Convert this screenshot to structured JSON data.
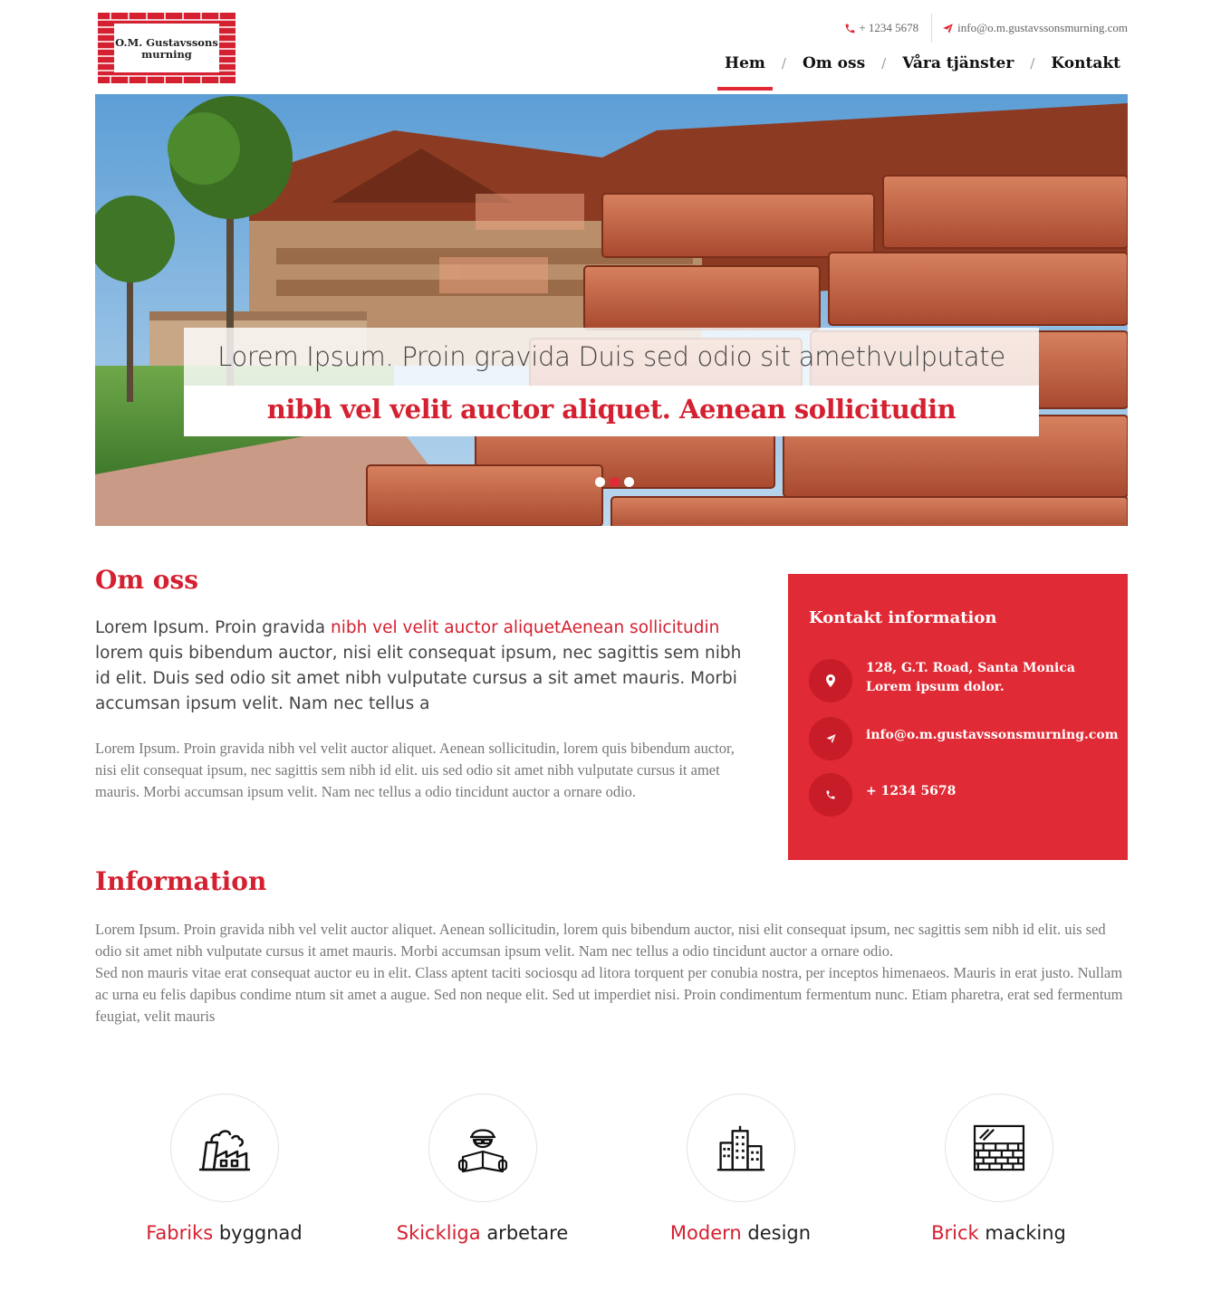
{
  "logo": {
    "line1": "O.M. Gustavssons",
    "line2": "murning"
  },
  "topbar": {
    "phone": "+ 1234 5678",
    "email": "info@o.m.gustavssonsmurning.com"
  },
  "nav": {
    "items": [
      "Hem",
      "Om oss",
      "Våra tjänster",
      "Kontakt"
    ],
    "separator": "/",
    "active": "Hem"
  },
  "hero": {
    "line1": "Lorem Ipsum. Proin gravida Duis sed odio sit amethvulputate",
    "line2": "nibh vel velit auctor aliquet. Aenean sollicitudin",
    "slides": 3,
    "active_slide": 2
  },
  "om_oss": {
    "title": "Om oss",
    "lead_start": "Lorem Ipsum. Proin gravida ",
    "lead_highlight": "nibh vel velit auctor aliquetAenean sollicitudin",
    "lead_end": " lorem quis bibendum auctor, nisi elit consequat ipsum, nec sagittis sem nibh id elit. Duis sed odio sit amet nibh vulputate cursus a sit amet mauris. Morbi accumsan ipsum velit. Nam nec tellus a",
    "body": "Lorem Ipsum. Proin gravida nibh vel velit auctor aliquet. Aenean sollicitudin, lorem quis bibendum auctor, nisi elit consequat ipsum, nec sagittis sem nibh id elit. uis sed odio sit amet nibh vulputate cursus it amet mauris. Morbi accumsan ipsum velit. Nam nec tellus a odio tincidunt auctor a ornare odio."
  },
  "contact": {
    "title": "Kontakt information",
    "address": "128, G.T. Road, Santa Monica Lorem ipsum dolor.",
    "email": "info@o.m.gustavssonsmurning.com",
    "phone": "+ 1234 5678"
  },
  "information": {
    "title": "Information",
    "para1": "Lorem Ipsum. Proin gravida nibh vel velit auctor aliquet. Aenean sollicitudin, lorem quis bibendum auctor, nisi elit consequat ipsum, nec sagittis sem nibh id elit. uis sed odio sit amet nibh vulputate cursus it amet mauris. Morbi accumsan ipsum velit. Nam nec tellus a odio tincidunt auctor a ornare odio.",
    "para2": "Sed non mauris vitae erat consequat auctor eu in elit. Class aptent taciti sociosqu ad litora torquent per conubia nostra, per inceptos himenaeos. Mauris in erat justo. Nullam ac urna eu felis dapibus condime ntum sit amet a augue. Sed non neque elit. Sed ut imperdiet nisi. Proin condimentum fermentum nunc. Etiam pharetra, erat sed fermentum feugiat, velit mauris"
  },
  "features": [
    {
      "red": "Fabriks",
      "rest": " byggnad",
      "icon": "factory-icon"
    },
    {
      "red": "Skickliga",
      "rest": " arbetare",
      "icon": "worker-icon"
    },
    {
      "red": "Modern",
      "rest": " design",
      "icon": "buildings-icon"
    },
    {
      "red": "Brick",
      "rest": " macking",
      "icon": "brick-wall-icon"
    }
  ],
  "colors": {
    "accent": "#e02a35",
    "accent_text": "#d42030",
    "contact_icon_bg": "#c81d28"
  }
}
